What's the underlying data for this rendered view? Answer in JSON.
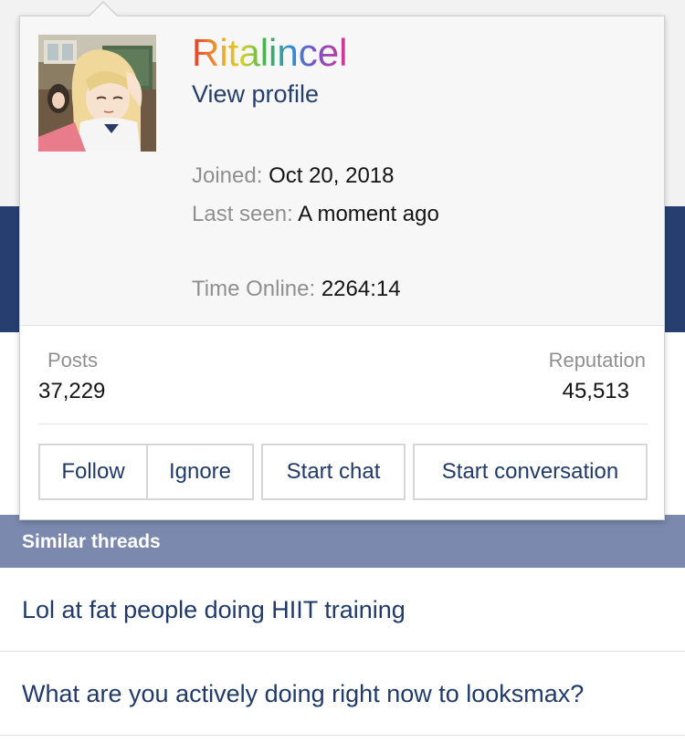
{
  "popup": {
    "username": "Ritalincel",
    "view_profile": "View profile",
    "joined_label": "Joined:",
    "joined_value": "Oct 20, 2018",
    "last_seen_label": "Last seen:",
    "last_seen_value": "A moment ago",
    "time_online_label": "Time Online:",
    "time_online_value": "2264:14",
    "stats": {
      "posts_label": "Posts",
      "posts_value": "37,229",
      "reputation_label": "Reputation",
      "reputation_value": "45,513"
    },
    "actions": {
      "follow": "Follow",
      "ignore": "Ignore",
      "start_chat": "Start chat",
      "start_conversation": "Start conversation"
    },
    "avatar_icon": "anime-avatar"
  },
  "similar_threads": {
    "header": "Similar threads",
    "items": [
      "Lol at fat people doing HIIT training",
      "What are you actively doing right now to looksmax?"
    ]
  },
  "colors": {
    "link": "#1f3a6b",
    "band": "#263f70",
    "section_header": "#7a89ad",
    "muted_label": "#8f8f8f"
  }
}
